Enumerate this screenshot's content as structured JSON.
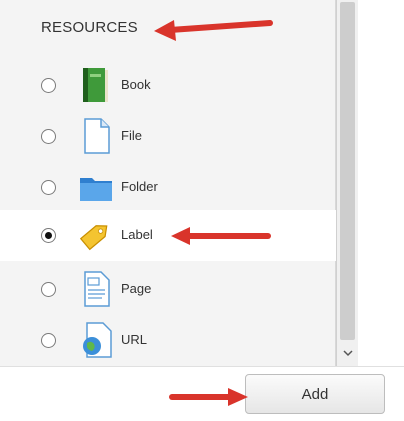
{
  "section": {
    "heading": "RESOURCES"
  },
  "options": [
    {
      "label": "Book",
      "icon": "book-icon",
      "selected": false
    },
    {
      "label": "File",
      "icon": "file-icon",
      "selected": false
    },
    {
      "label": "Folder",
      "icon": "folder-icon",
      "selected": false
    },
    {
      "label": "Label",
      "icon": "label-tag-icon",
      "selected": true
    },
    {
      "label": "Page",
      "icon": "page-icon",
      "selected": false
    },
    {
      "label": "URL",
      "icon": "url-icon",
      "selected": false
    }
  ],
  "footer": {
    "add_label": "Add"
  },
  "colors": {
    "arrow": "#d9342b",
    "panel": "#f4f4f4",
    "selected_row": "#ffffff"
  }
}
